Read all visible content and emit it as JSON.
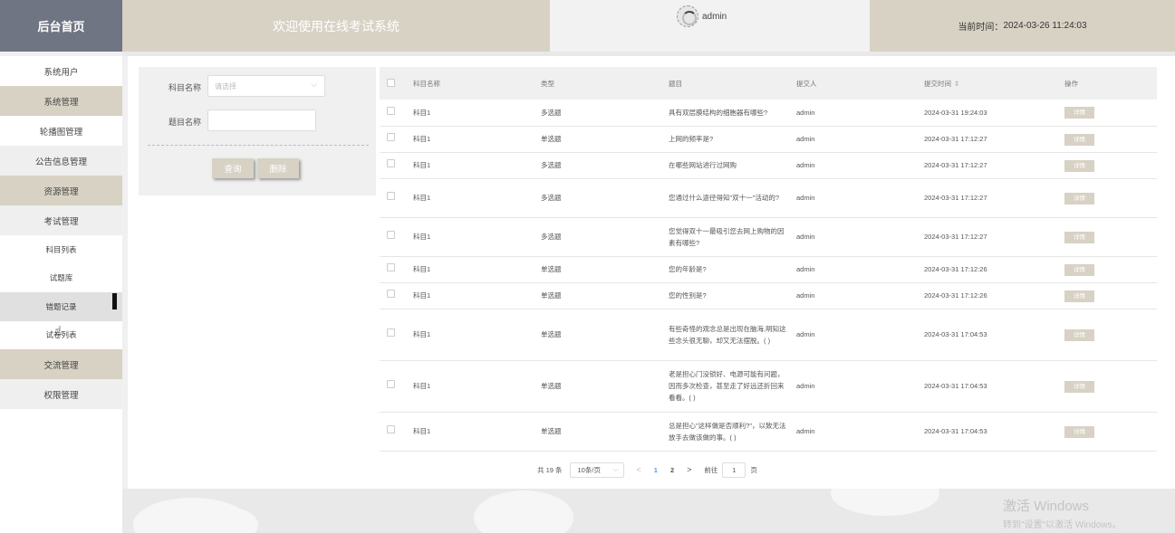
{
  "header": {
    "brand": "后台首页",
    "welcome": "欢迎使用在线考试系统",
    "username": "admin",
    "time_label": "当前时间：",
    "time_value": "2024-03-26 11:24:03"
  },
  "sidebar": {
    "items": [
      {
        "label": "系统用户"
      },
      {
        "label": "系统管理"
      },
      {
        "label": "轮播图管理"
      },
      {
        "label": "公告信息管理"
      },
      {
        "label": "资源管理"
      },
      {
        "label": "考试管理"
      },
      {
        "label": "科目列表"
      },
      {
        "label": "试题库"
      },
      {
        "label": "错题记录"
      },
      {
        "label": "试卷列表"
      },
      {
        "label": "交流管理"
      },
      {
        "label": "权限管理"
      }
    ]
  },
  "search": {
    "subject_label": "科目名称",
    "subject_placeholder": "请选择",
    "title_label": "题目名称",
    "query_button": "查询",
    "delete_button": "删除"
  },
  "table": {
    "columns": [
      "科目名称",
      "类型",
      "题目",
      "提交人",
      "提交时间",
      "操作"
    ],
    "detail_label": "详情",
    "rows": [
      {
        "subject": "科目1",
        "type": "多选题",
        "question": "具有双层膜结构的细胞器有哪些?",
        "submitter": "admin",
        "time": "2024-03-31 19:24:03"
      },
      {
        "subject": "科目1",
        "type": "单选题",
        "question": "上网的频率是?",
        "submitter": "admin",
        "time": "2024-03-31 17:12:27"
      },
      {
        "subject": "科目1",
        "type": "多选题",
        "question": "在哪些网站进行过网购",
        "submitter": "admin",
        "time": "2024-03-31 17:12:27"
      },
      {
        "subject": "科目1",
        "type": "多选题",
        "question": "您通过什么途径得知\"双十一\"活动的?",
        "submitter": "admin",
        "time": "2024-03-31 17:12:27"
      },
      {
        "subject": "科目1",
        "type": "多选题",
        "question": "您觉得双十一最吸引您去网上购物的因素有哪些?",
        "submitter": "admin",
        "time": "2024-03-31 17:12:27"
      },
      {
        "subject": "科目1",
        "type": "单选题",
        "question": "您的年龄是?",
        "submitter": "admin",
        "time": "2024-03-31 17:12:26"
      },
      {
        "subject": "科目1",
        "type": "单选题",
        "question": "您的性别是?",
        "submitter": "admin",
        "time": "2024-03-31 17:12:26"
      },
      {
        "subject": "科目1",
        "type": "单选题",
        "question": "有些奇怪的观念总是出现在脑海,明知这些念头很无聊，却又无法摆脱。( )",
        "submitter": "admin",
        "time": "2024-03-31 17:04:53"
      },
      {
        "subject": "科目1",
        "type": "单选题",
        "question": "老是担心门没锁好、电源可能有问题，因而多次检查，甚至走了好远还折回来看看。( )",
        "submitter": "admin",
        "time": "2024-03-31 17:04:53"
      },
      {
        "subject": "科目1",
        "type": "单选题",
        "question": "总是担心\"这样做是否顺利?\"，以致无法放手去做该做的事。( )",
        "submitter": "admin",
        "time": "2024-03-31 17:04:53"
      }
    ]
  },
  "pagination": {
    "total": "共 19 条",
    "page_size": "10条/页",
    "prev": "<",
    "pages": [
      "1",
      "2"
    ],
    "next": ">",
    "goto_label": "前往",
    "goto_value": "1",
    "goto_suffix": "页"
  },
  "watermark": {
    "line1": "激活 Windows",
    "line2": "转到\"设置\"以激活 Windows。"
  }
}
